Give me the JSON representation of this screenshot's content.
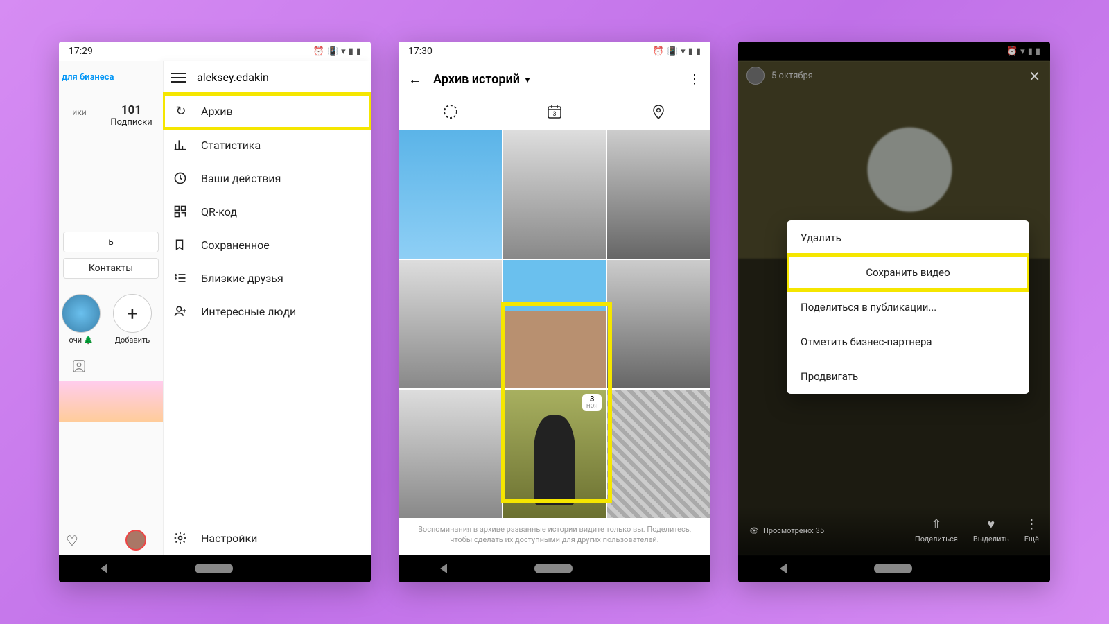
{
  "phone1": {
    "time": "17:29",
    "business_link": "для бизнеса",
    "stat_left_cut": "ики",
    "stat_num": "101",
    "stat_label": "Подписки",
    "btn_edit_cut": "ь",
    "btn_contacts": "Контакты",
    "highlight1": "очи 🌲",
    "highlight2": "Добавить",
    "username": "aleksey.edakin",
    "menu": {
      "archive": "Архив",
      "stats": "Статистика",
      "actions": "Ваши действия",
      "qr": "QR-код",
      "saved": "Сохраненное",
      "close_friends": "Близкие друзья",
      "people": "Интересные люди",
      "settings": "Настройки"
    }
  },
  "phone2": {
    "time": "17:30",
    "title": "Архив историй",
    "calendar_day": "3",
    "date_badge_day": "3",
    "date_badge_month": "НОЯ",
    "footer": "Воспоминания в архиве разванные истории видите только вы. Поделитесь, чтобы сделать их доступными для других пользователей."
  },
  "phone3": {
    "story_date": "5 октября",
    "views_label": "Просмотрено: 35",
    "share": "Поделиться",
    "highlight": "Выделить",
    "more": "Ещё",
    "menu": {
      "delete": "Удалить",
      "save_video": "Сохранить видео",
      "share_post": "Поделиться в публикации...",
      "tag_partner": "Отметить бизнес-партнера",
      "promote": "Продвигать"
    }
  }
}
